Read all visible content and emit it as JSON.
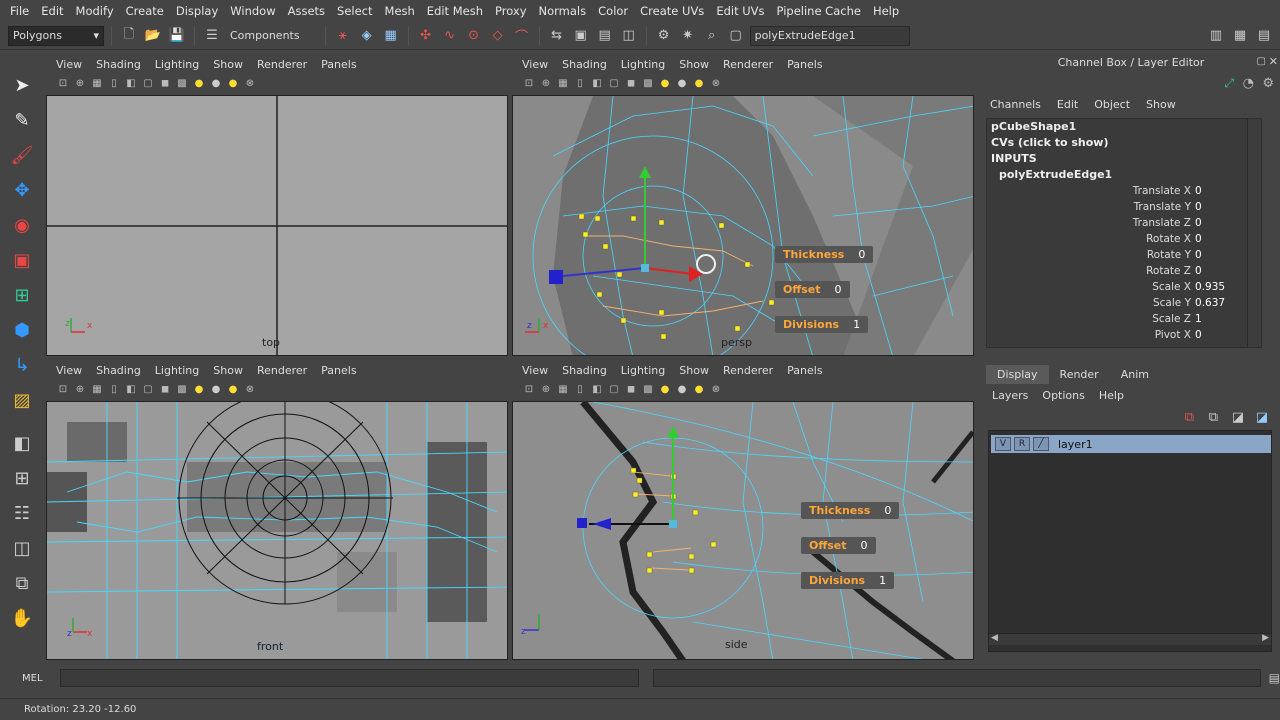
{
  "menubar": [
    "File",
    "Edit",
    "Modify",
    "Create",
    "Display",
    "Window",
    "Assets",
    "Select",
    "Mesh",
    "Edit Mesh",
    "Proxy",
    "Normals",
    "Color",
    "Create UVs",
    "Edit UVs",
    "Pipeline Cache",
    "Help"
  ],
  "statusline": {
    "menu_set": "Polygons",
    "components_label": "Components",
    "node_name": "polyExtrudeEdge1"
  },
  "viewport_menu": [
    "View",
    "Shading",
    "Lighting",
    "Show",
    "Renderer",
    "Panels"
  ],
  "viewports": {
    "top": {
      "label": "top"
    },
    "persp": {
      "label": "persp"
    },
    "front": {
      "label": "front"
    },
    "side": {
      "label": "side"
    }
  },
  "hud": {
    "thickness_label": "Thickness",
    "thickness_value": "0",
    "offset_label": "Offset",
    "offset_value": "0",
    "divisions_label": "Divisions",
    "divisions_value": "1"
  },
  "channelbox": {
    "title": "Channel Box / Layer Editor",
    "menu": [
      "Channels",
      "Edit",
      "Object",
      "Show"
    ],
    "shape": "pCubeShape1",
    "cvs": "CVs (click to show)",
    "inputs": "INPUTS",
    "node": "polyExtrudeEdge1",
    "attrs": [
      {
        "name": "Translate X",
        "value": "0"
      },
      {
        "name": "Translate Y",
        "value": "0"
      },
      {
        "name": "Translate Z",
        "value": "0"
      },
      {
        "name": "Rotate X",
        "value": "0"
      },
      {
        "name": "Rotate Y",
        "value": "0"
      },
      {
        "name": "Rotate Z",
        "value": "0"
      },
      {
        "name": "Scale X",
        "value": "0.935"
      },
      {
        "name": "Scale Y",
        "value": "0.637"
      },
      {
        "name": "Scale Z",
        "value": "1"
      },
      {
        "name": "Pivot X",
        "value": "0"
      }
    ]
  },
  "layereditor": {
    "tabs": [
      "Display",
      "Render",
      "Anim"
    ],
    "menu": [
      "Layers",
      "Options",
      "Help"
    ],
    "layer": {
      "v": "V",
      "r": "R",
      "name": "layer1"
    }
  },
  "cmdline": {
    "label": "MEL"
  },
  "helpline": {
    "text": "Rotation:  23.20   -12.60"
  },
  "colors": {
    "wire": "#48d8ff",
    "hud_label": "#ffa53a",
    "selected_layer": "#89a6c6"
  }
}
